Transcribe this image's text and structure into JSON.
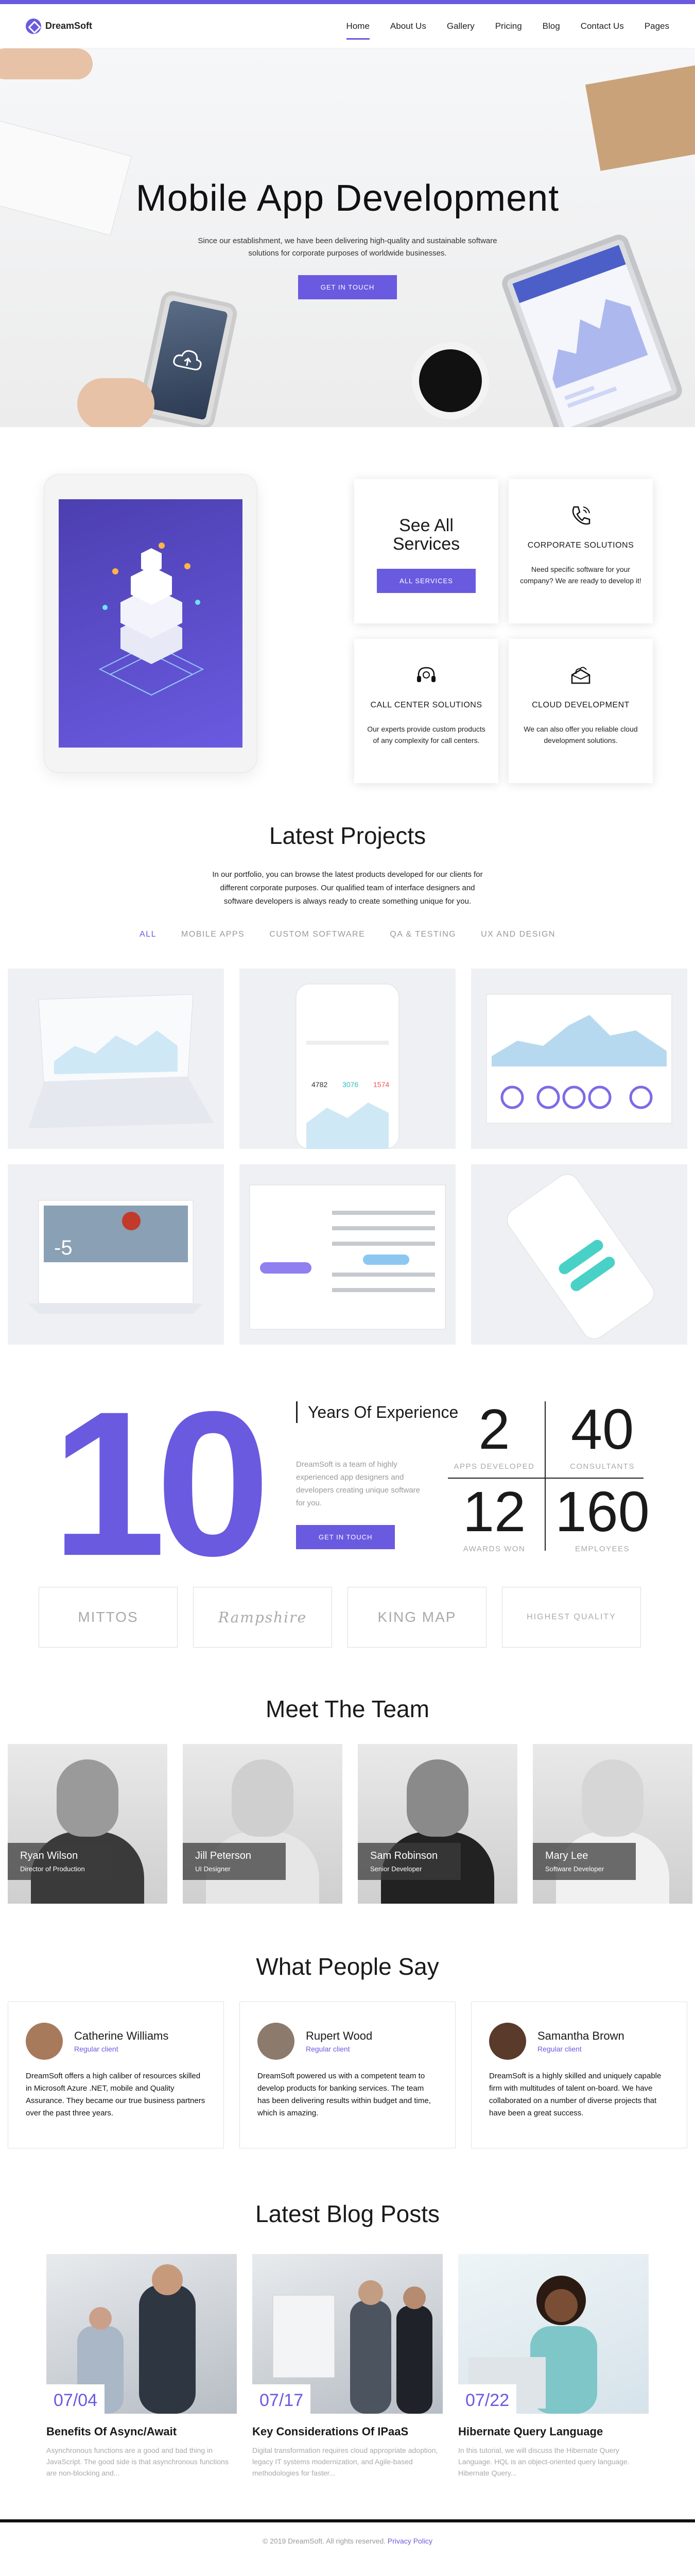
{
  "brand": {
    "name": "DreamSoft"
  },
  "nav": {
    "items": [
      {
        "label": "Home"
      },
      {
        "label": "About Us"
      },
      {
        "label": "Gallery"
      },
      {
        "label": "Pricing"
      },
      {
        "label": "Blog"
      },
      {
        "label": "Contact Us"
      },
      {
        "label": "Pages"
      }
    ]
  },
  "hero": {
    "title": "Mobile App Development",
    "text": "Since our establishment, we have been delivering high-quality and sustainable software solutions for corporate purposes of worldwide businesses.",
    "button": "GET IN TOUCH"
  },
  "services": {
    "title": "See All Services",
    "button": "ALL SERVICES",
    "cards": [
      {
        "title": "CORPORATE SOLUTIONS",
        "text": "Need specific software for your company? We are ready to develop it!",
        "icon": "phone-icon"
      },
      {
        "title": "CALL CENTER SOLUTIONS",
        "text": "Our experts provide custom products of any complexity for call centers.",
        "icon": "headset-icon"
      },
      {
        "title": "CLOUD DEVELOPMENT",
        "text": "We can also offer you reliable cloud development solutions.",
        "icon": "cloud-box-icon"
      }
    ]
  },
  "projects": {
    "title": "Latest Projects",
    "text": "In our portfolio, you can browse the latest products developed for our clients for different corporate purposes. Our qualified team of interface designers and software developers is always ready to create something unique for you.",
    "filters": [
      {
        "label": "ALL"
      },
      {
        "label": "MOBILE APPS"
      },
      {
        "label": "CUSTOM SOFTWARE"
      },
      {
        "label": "QA & TESTING"
      },
      {
        "label": "UX AND DESIGN"
      }
    ]
  },
  "stats": {
    "big_number": "10",
    "years_title": "Years Of Experience",
    "years_text": "DreamSoft is a team of highly experienced app designers and developers creating unique software for you.",
    "button": "GET IN TOUCH",
    "items": [
      {
        "value": "2",
        "label": "APPS DEVELOPED"
      },
      {
        "value": "40",
        "label": "CONSULTANTS"
      },
      {
        "value": "12",
        "label": "AWARDS WON"
      },
      {
        "value": "160",
        "label": "EMPLOYEES"
      }
    ]
  },
  "brands": [
    {
      "label": "MITTOS"
    },
    {
      "label": "Rampshire"
    },
    {
      "label": "KING MAP"
    },
    {
      "label": "HIGHEST QUALITY"
    }
  ],
  "team": {
    "title": "Meet The Team",
    "members": [
      {
        "name": "Ryan Wilson",
        "role": "Director of Production"
      },
      {
        "name": "Jill Peterson",
        "role": "UI Designer"
      },
      {
        "name": "Sam Robinson",
        "role": "Senior Developer"
      },
      {
        "name": "Mary Lee",
        "role": "Software Developer"
      }
    ]
  },
  "testimonials": {
    "title": "What People Say",
    "items": [
      {
        "name": "Catherine Williams",
        "role": "Regular client",
        "text": "DreamSoft offers a high caliber of resources skilled in Microsoft Azure .NET, mobile and Quality Assurance. They became our true business partners over the past three years."
      },
      {
        "name": "Rupert Wood",
        "role": "Regular client",
        "text": "DreamSoft powered us with a competent team to develop products for banking services. The team has been delivering results within budget and time, which is amazing."
      },
      {
        "name": "Samantha Brown",
        "role": "Regular client",
        "text": "DreamSoft is a highly skilled and uniquely capable firm with multitudes of talent on-board. We have collaborated on a number of diverse projects that have been a great success."
      }
    ]
  },
  "blog": {
    "title": "Latest Blog Posts",
    "posts": [
      {
        "month": "07",
        "day": "04",
        "title": "Benefits Of Async/Await",
        "text": "Asynchronous functions are a good and bad thing in JavaScript. The good side is that asynchronous functions are non-blocking and..."
      },
      {
        "month": "07",
        "day": "17",
        "title": "Key Considerations Of IPaaS",
        "text": "Digital transformation requires cloud appropriate adoption, legacy IT systems modernization, and Agile-based methodologies for faster..."
      },
      {
        "month": "07",
        "day": "22",
        "title": "Hibernate Query Language",
        "text": "In this tutorial, we will discuss the Hibernate Query Language. HQL is an object-oriented query language. Hibernate Query..."
      }
    ]
  },
  "footer": {
    "copyright": "© 2019 DreamSoft. All rights reserved.",
    "privacy": "Privacy Policy"
  },
  "colors": {
    "accent": "#6a5ae0"
  }
}
